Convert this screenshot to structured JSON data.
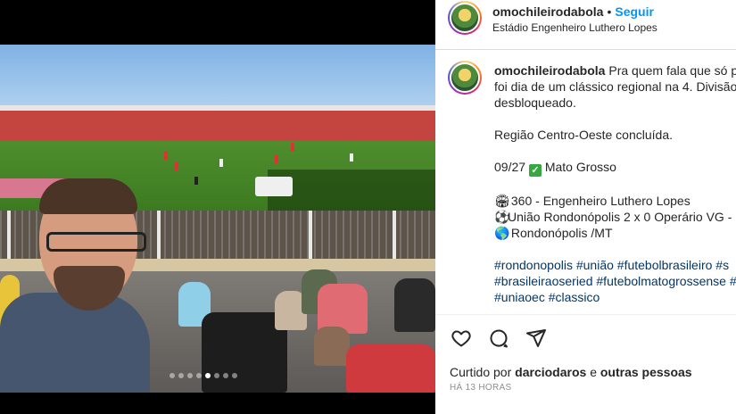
{
  "post": {
    "username": "omochileirodabola",
    "follow_label": "Seguir",
    "separator": "•",
    "location": "Estádio Engenheiro Luthero Lopes",
    "caption": {
      "username": "omochileirodabola",
      "line1": "Pra quem fala que só pe",
      "line2": "foi dia de um clássico regional na 4. Divisão",
      "line3": "desbloqueado.",
      "line4": "Região Centro-Oeste concluída.",
      "line5_prefix": "09/27",
      "line5_check": "✓",
      "line5_text": "Mato Grosso",
      "line6_icon": "🏟",
      "line6_text": "360 - Engenheiro Luthero Lopes",
      "line7_icon": "⚽",
      "line7_text": "União Rondonópolis 2 x 0 Operário VG -",
      "line8_icon": "🌎",
      "line8_text": "Rondonópolis /MT",
      "tags1": "#rondonopolis #união #futebolbrasileiro #s",
      "tags2": "#brasileiraoseried #futebolmatogrossense #",
      "tags3": "#uniaoec #classico"
    },
    "liked_by_prefix": "Curtido por",
    "liked_by_user": "darciodaros",
    "liked_by_and": "e",
    "liked_by_others": "outras pessoas",
    "timestamp": "HÁ 13 HORAS",
    "carousel": {
      "count": 8,
      "active_index": 4
    },
    "icons": [
      "heart-icon",
      "comment-icon",
      "share-icon"
    ],
    "colors": {
      "follow": "#0095f6",
      "hashtag": "#00376b",
      "meta": "#8e8e8e"
    }
  }
}
